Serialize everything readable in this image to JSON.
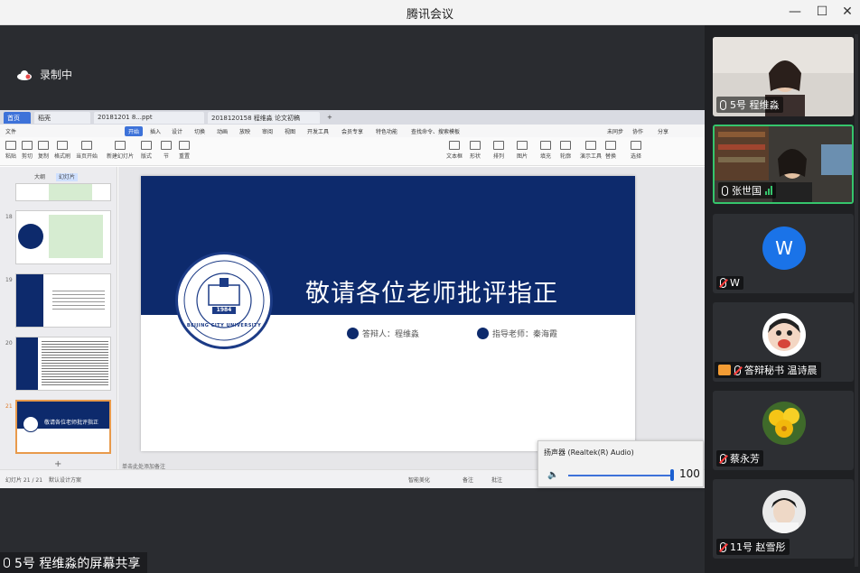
{
  "window": {
    "title": "腾讯会议",
    "min": "—",
    "max": "☐",
    "close": "✕"
  },
  "recording": {
    "label": "录制中"
  },
  "shared_app": {
    "tabs": [
      {
        "label": "首页"
      },
      {
        "label": "稻壳"
      },
      {
        "label": "20181201 8...ppt"
      },
      {
        "label": "2018120158 程维淼 论文初稿"
      }
    ],
    "menu": [
      "文件",
      "开始",
      "插入",
      "设计",
      "切换",
      "动画",
      "放映",
      "审阅",
      "视图",
      "开发工具",
      "会员专享",
      "特色功能",
      "查找命令、搜索模板"
    ],
    "menu_right": [
      "未同步",
      "协作",
      "分享"
    ],
    "ribbon": [
      "粘贴",
      "剪切",
      "复制",
      "格式刷",
      "当页开始",
      "新建幻灯片",
      "版式",
      "节",
      "重置",
      "文本框",
      "形状",
      "排列",
      "图片",
      "填充",
      "轮廓",
      "演示工具",
      "替换",
      "选择"
    ],
    "thumb_tabs": [
      "大纲",
      "幻灯片"
    ],
    "thumbs": [
      {
        "num": "18"
      },
      {
        "num": "19"
      },
      {
        "num": "20"
      },
      {
        "num": "21"
      }
    ],
    "slide": {
      "headline": "敬请各位老师批评指正",
      "presenter": "答辩人：程维淼",
      "advisor": "指导老师：秦海霞",
      "emblem_year": "1984",
      "emblem_text": "BEIJING CITY UNIVERSITY"
    },
    "notes_placeholder": "单击此处添加备注",
    "status": {
      "page": "幻灯片 21 / 21",
      "theme": "默认设计方案",
      "beautify": "智能美化",
      "notes": "备注",
      "comments": "批注"
    }
  },
  "audio_popup": {
    "device": "扬声器 (Realtek(R) Audio)",
    "volume": "100",
    "volume_level": 1.0
  },
  "share_label": "5号 程维淼的屏幕共享",
  "participants": [
    {
      "name": "5号 程维淼",
      "muted": false,
      "type": "video"
    },
    {
      "name": "张世国",
      "muted": false,
      "type": "video",
      "speaking": true
    },
    {
      "name": "W",
      "muted": true,
      "type": "avatar-letter",
      "letter": "W"
    },
    {
      "name": "答辩秘书 温诗晨",
      "muted": true,
      "type": "avatar-image"
    },
    {
      "name": "蔡永芳",
      "muted": true,
      "type": "avatar-image"
    },
    {
      "name": "11号 赵雪彤",
      "muted": true,
      "type": "avatar-image"
    }
  ],
  "colors": {
    "slide_band": "#0d2a6c",
    "active_tile": "#35c56c",
    "mute_red": "#ff3b3b",
    "accent_blue": "#3d72d9"
  }
}
